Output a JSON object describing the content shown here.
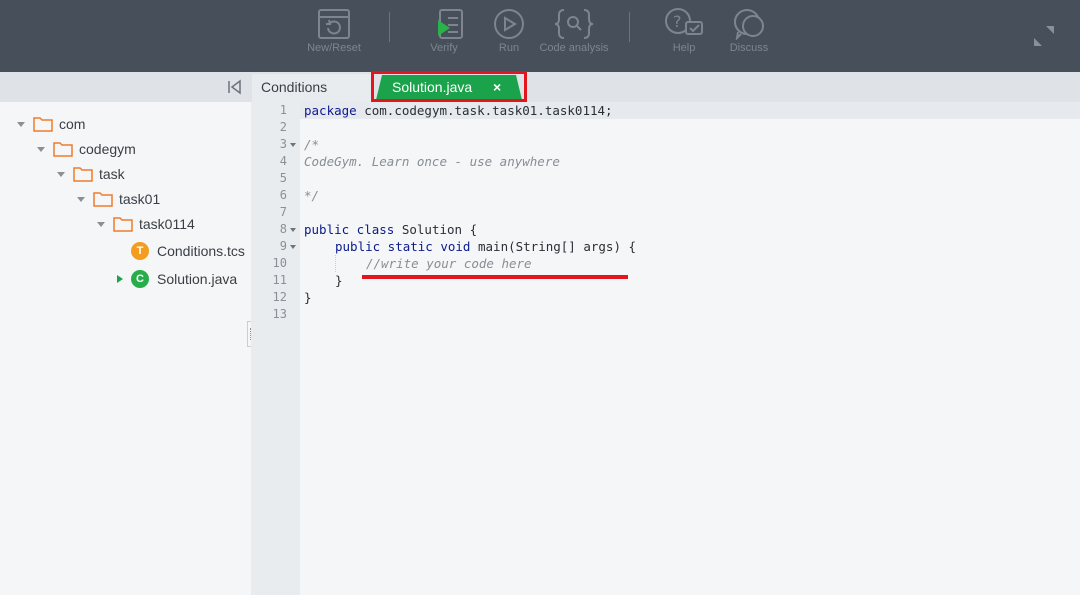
{
  "toolbar": {
    "buttons": [
      {
        "id": "new-reset",
        "label": "New/Reset"
      },
      {
        "id": "verify",
        "label": "Verify"
      },
      {
        "id": "run",
        "label": "Run"
      },
      {
        "id": "code-analysis",
        "label": "Code analysis"
      },
      {
        "id": "help",
        "label": "Help"
      },
      {
        "id": "discuss",
        "label": "Discuss"
      }
    ]
  },
  "tabs": {
    "conditions": "Conditions",
    "active": "Solution.java",
    "close": "×"
  },
  "tree": [
    {
      "label": "com",
      "type": "folder"
    },
    {
      "label": "codegym",
      "type": "folder"
    },
    {
      "label": "task",
      "type": "folder"
    },
    {
      "label": "task01",
      "type": "folder"
    },
    {
      "label": "task0114",
      "type": "folder"
    },
    {
      "label": "Conditions.tcs",
      "type": "file",
      "badge": "T"
    },
    {
      "label": "Solution.java",
      "type": "file",
      "badge": "C"
    }
  ],
  "editor": {
    "line_numbers": [
      "1",
      "2",
      "3",
      "4",
      "5",
      "6",
      "7",
      "8",
      "9",
      "10",
      "11",
      "12",
      "13"
    ],
    "lines": {
      "l1_kw": "package",
      "l1_rest": " com.codegym.task.task01.task0114;",
      "l3": "/*",
      "l4": "CodeGym. Learn once - use anywhere",
      "l6": "*/",
      "l8_kw": "public class",
      "l8_rest": " Solution {",
      "l9_kw": "public static void",
      "l9_rest": " main(String[] args) {",
      "l10": "//write your code here",
      "l11": "}",
      "l12": "}"
    }
  },
  "colors": {
    "toolbar_bg": "#474f5a",
    "active_tab": "#1aa34a",
    "highlight_red": "#e3161e",
    "keyword": "#0c1a8c"
  }
}
